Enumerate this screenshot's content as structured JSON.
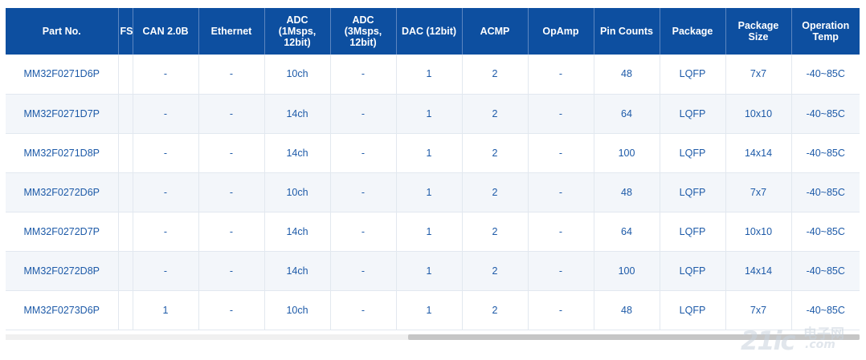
{
  "table": {
    "columns": [
      {
        "label": "Part No.",
        "key": "part"
      },
      {
        "label": "FS",
        "key": "fs"
      },
      {
        "label": "CAN 2.0B",
        "key": "can"
      },
      {
        "label": "Ethernet",
        "key": "eth"
      },
      {
        "label": "ADC\n(1Msps,\n12bit)",
        "key": "adc1"
      },
      {
        "label": "ADC\n(3Msps,\n12bit)",
        "key": "adc3"
      },
      {
        "label": "DAC (12bit)",
        "key": "dac"
      },
      {
        "label": "ACMP",
        "key": "acmp"
      },
      {
        "label": "OpAmp",
        "key": "opamp"
      },
      {
        "label": "Pin Counts",
        "key": "pins"
      },
      {
        "label": "Package",
        "key": "pkg"
      },
      {
        "label": "Package\nSize",
        "key": "size"
      },
      {
        "label": "Operation\nTemp",
        "key": "temp"
      }
    ],
    "rows": [
      [
        "MM32F0271D6P",
        "",
        "-",
        "-",
        "10ch",
        "-",
        "1",
        "2",
        "-",
        "48",
        "LQFP",
        "7x7",
        "-40~85C"
      ],
      [
        "MM32F0271D7P",
        "",
        "-",
        "-",
        "14ch",
        "-",
        "1",
        "2",
        "-",
        "64",
        "LQFP",
        "10x10",
        "-40~85C"
      ],
      [
        "MM32F0271D8P",
        "",
        "-",
        "-",
        "14ch",
        "-",
        "1",
        "2",
        "-",
        "100",
        "LQFP",
        "14x14",
        "-40~85C"
      ],
      [
        "MM32F0272D6P",
        "",
        "-",
        "-",
        "10ch",
        "-",
        "1",
        "2",
        "-",
        "48",
        "LQFP",
        "7x7",
        "-40~85C"
      ],
      [
        "MM32F0272D7P",
        "",
        "-",
        "-",
        "14ch",
        "-",
        "1",
        "2",
        "-",
        "64",
        "LQFP",
        "10x10",
        "-40~85C"
      ],
      [
        "MM32F0272D8P",
        "",
        "-",
        "-",
        "14ch",
        "-",
        "1",
        "2",
        "-",
        "100",
        "LQFP",
        "14x14",
        "-40~85C"
      ],
      [
        "MM32F0273D6P",
        "",
        "1",
        "-",
        "10ch",
        "-",
        "1",
        "2",
        "-",
        "48",
        "LQFP",
        "7x7",
        "-40~85C"
      ]
    ]
  },
  "watermark": {
    "number": "21ic",
    "chinese": "电子网",
    "site": ".com"
  },
  "colors": {
    "header_bg": "#0d4fa0",
    "cell_text": "#1d5aa8",
    "stripe": "#f3f6fa"
  }
}
